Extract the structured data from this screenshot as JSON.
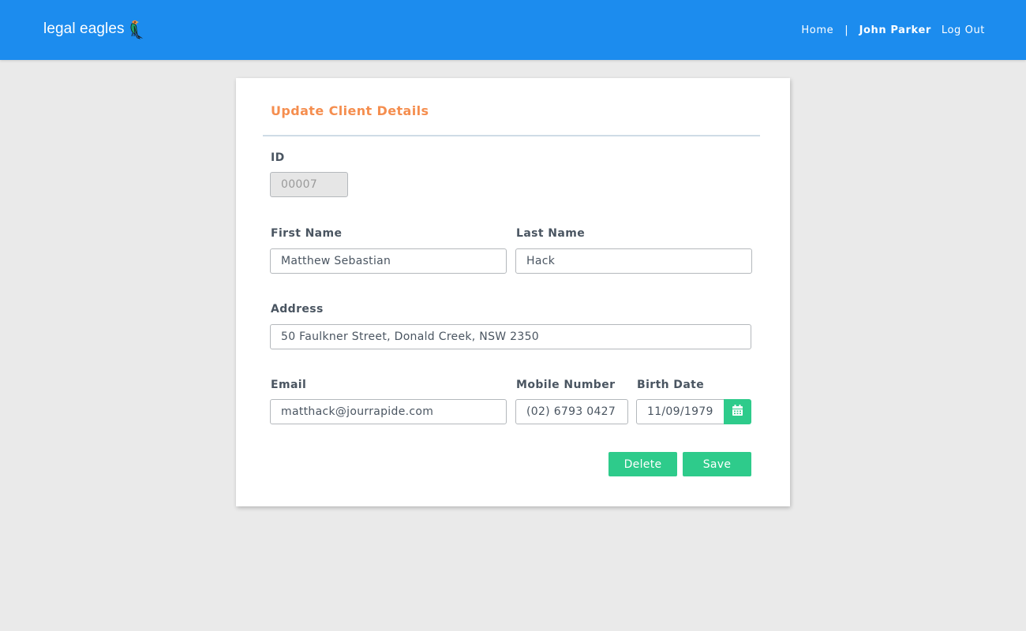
{
  "header": {
    "logo_text": "legal eagles",
    "nav": {
      "home": "Home",
      "separator": "|",
      "user": "John Parker",
      "logout": "Log Out"
    },
    "bar_color": "#1c8cee"
  },
  "form": {
    "title": "Update Client Details",
    "id": {
      "label": "ID",
      "value": "00007"
    },
    "first_name": {
      "label": "First Name",
      "value": "Matthew Sebastian"
    },
    "last_name": {
      "label": "Last Name",
      "value": "Hack"
    },
    "address": {
      "label": "Address",
      "value": "50 Faulkner Street, Donald Creek, NSW 2350"
    },
    "email": {
      "label": "Email",
      "value": "matthack@jourrapide.com"
    },
    "mobile": {
      "label": "Mobile Number",
      "value": "(02) 6793 0427"
    },
    "birth_date": {
      "label": "Birth Date",
      "value": "11/09/1979",
      "icon": "calendar-icon"
    },
    "buttons": {
      "delete": "Delete",
      "save": "Save"
    }
  },
  "colors": {
    "accent_green": "#2ecb8b",
    "title_orange": "#f58e4f",
    "label_text": "#4a5561"
  }
}
